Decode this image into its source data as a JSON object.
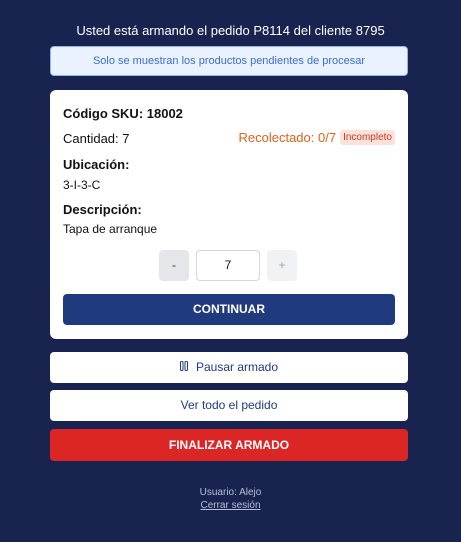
{
  "header": {
    "title": "Usted está armando el pedido P8114 del cliente 8795",
    "banner": "Solo se muestran los productos pendientes de procesar"
  },
  "item": {
    "sku": "Código SKU: 18002",
    "quantity_label": "Cantidad:",
    "quantity_value": "7",
    "collected": "Recolectado: 0/7",
    "status_badge": "Incompleto",
    "location_label": "Ubicación:",
    "location_value": "3-I-3-C",
    "description_label": "Descripción:",
    "description_value": "Tapa de arranque"
  },
  "stepper": {
    "minus": "-",
    "value": "7",
    "plus": "+"
  },
  "actions": {
    "continue": "CONTINUAR",
    "pause": "Pausar armado",
    "view_order": "Ver todo el pedido",
    "finish": "FINALIZAR ARMADO"
  },
  "footer": {
    "user": "Usuario: Alejo",
    "logout": "Cerrar sesión"
  },
  "colors": {
    "background": "#18234f",
    "primary": "#1f3a7d",
    "danger": "#dc2626",
    "warning": "#d9631c"
  }
}
